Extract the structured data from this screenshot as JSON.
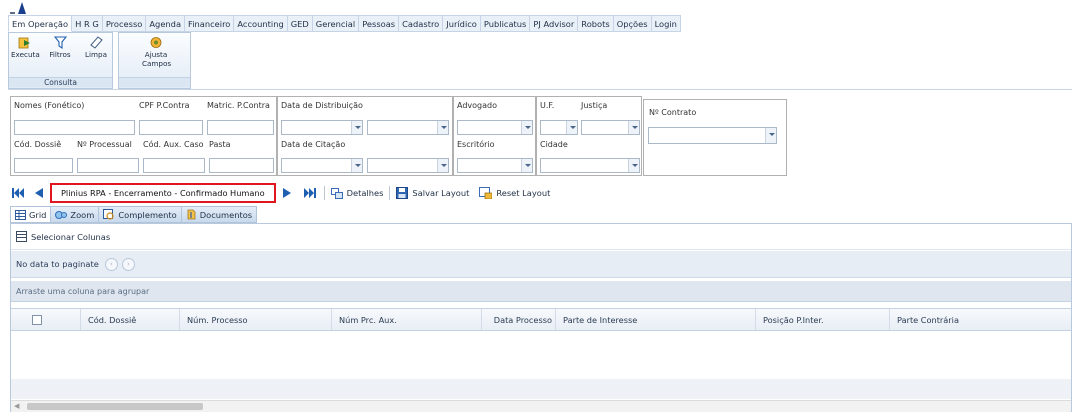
{
  "menu": {
    "tabs": [
      "Em Operação",
      "H R G",
      "Processo",
      "Agenda",
      "Financeiro",
      "Accounting",
      "GED",
      "Gerencial",
      "Pessoas",
      "Cadastro",
      "Jurídico",
      "Publicatus",
      "PJ Advisor",
      "Robots",
      "Opções",
      "Login"
    ],
    "active_index": 0
  },
  "ribbon": {
    "executa": "Executa",
    "filtros": "Filtros",
    "limpa": "Limpa",
    "consulta_group": "Consulta",
    "ajusta_campos_line1": "Ajusta",
    "ajusta_campos_line2": "Campos"
  },
  "filters": {
    "nomes": "Nomes (Fonético)",
    "cpf": "CPF P.Contra",
    "matric": "Matric. P.Contra",
    "data_distribuicao": "Data de Distribuição",
    "advogado": "Advogado",
    "uf": "U.F.",
    "justica": "Justiça",
    "no_contrato": "Nº Contrato",
    "cod_dossie": "Cód. Dossiê",
    "no_processual": "Nº Processual",
    "cod_aux_caso": "Cód. Aux. Caso",
    "pasta": "Pasta",
    "data_citacao": "Data de Citação",
    "escritorio": "Escritório",
    "cidade": "Cidade"
  },
  "navigator": {
    "current": "Plinius RPA - Encerramento - Confirmado Humano",
    "detalhes": "Detalhes",
    "salvar_layout": "Salvar Layout",
    "reset_layout": "Reset Layout"
  },
  "view_tabs": [
    "Grid",
    "Zoom",
    "Complemento",
    "Documentos"
  ],
  "grid": {
    "selecionar_colunas": "Selecionar Colunas",
    "pager_text": "No data to paginate",
    "group_hint": "Arraste uma coluna para agrupar",
    "columns": [
      "Cód. Dossiê",
      "Núm. Processo",
      "Núm Prc. Aux.",
      "Data Processo",
      "Parte de Interesse",
      "Posição P.Inter.",
      "Parte Contrária"
    ]
  },
  "colors": {
    "accent_red": "#e0161e",
    "nav_blue": "#1f5fb0",
    "tab_bg": "#e9f0f8"
  }
}
